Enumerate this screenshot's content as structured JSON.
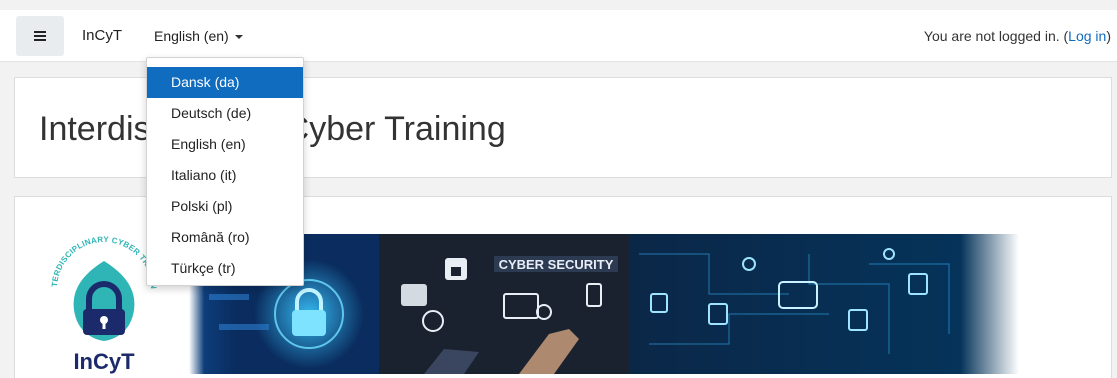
{
  "navbar": {
    "brand": "InCyT",
    "language_toggle": "English (en)",
    "login_prefix": "You are not logged in. (",
    "login_link": "Log in",
    "login_suffix": ")"
  },
  "language_menu": {
    "items": [
      {
        "label": "Dansk (da)",
        "active": true
      },
      {
        "label": "Deutsch (de)",
        "active": false
      },
      {
        "label": "English (en)",
        "active": false
      },
      {
        "label": "Italiano (it)",
        "active": false
      },
      {
        "label": "Polski (pl)",
        "active": false
      },
      {
        "label": "Română (ro)",
        "active": false
      },
      {
        "label": "Türkçe (tr)",
        "active": false
      }
    ]
  },
  "header": {
    "title": "Interdisciplinary Cyber Training"
  },
  "logo": {
    "ring_text": "INTERDISCIPLINARY CYBER TRAINING",
    "wordmark": "InCyT"
  },
  "banner": {
    "caption": "CYBER SECURITY"
  },
  "colors": {
    "accent": "#0f6cbf",
    "logo_teal": "#2fb5b5",
    "logo_navy": "#1b2a6b"
  }
}
